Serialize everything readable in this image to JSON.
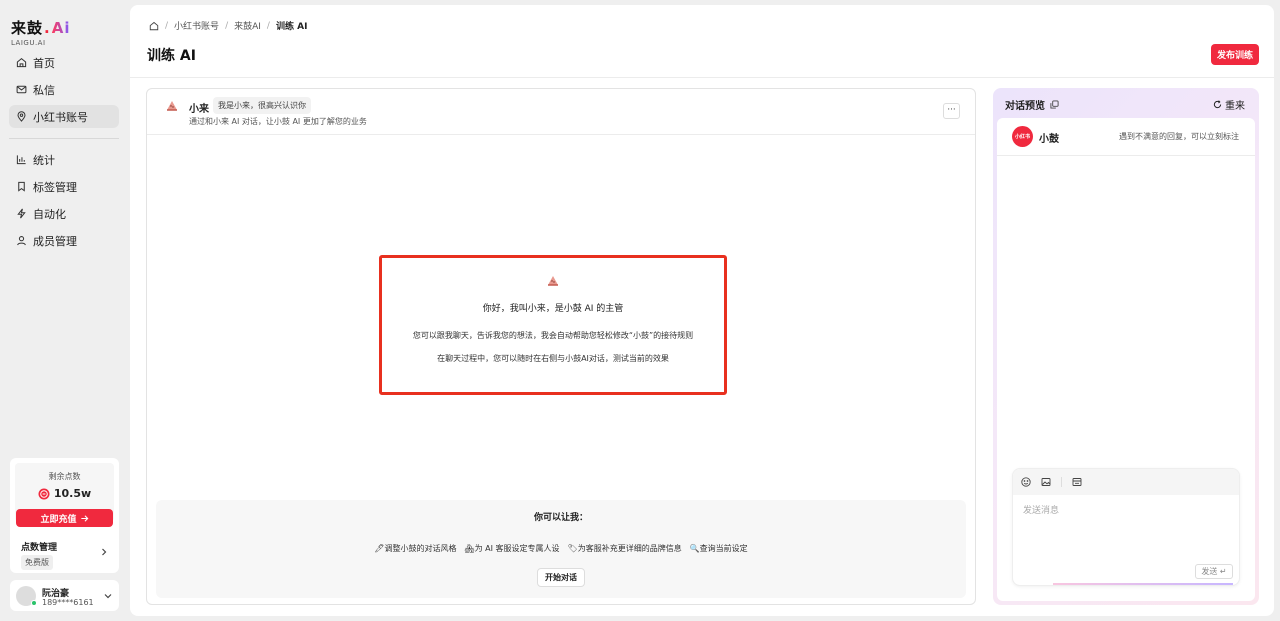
{
  "brand": {
    "name": "来鼓",
    "ai": "Ai",
    "sub": "LAIGU.AI"
  },
  "sidebar": {
    "items": [
      {
        "label": "首页",
        "icon": "home-icon"
      },
      {
        "label": "私信",
        "icon": "mail-icon"
      },
      {
        "label": "小红书账号",
        "icon": "location-pin-icon",
        "active": true
      }
    ],
    "items2": [
      {
        "label": "统计",
        "icon": "bar-chart-icon"
      },
      {
        "label": "标签管理",
        "icon": "bookmark-icon"
      },
      {
        "label": "自动化",
        "icon": "lightning-icon"
      },
      {
        "label": "成员管理",
        "icon": "user-icon"
      }
    ],
    "points": {
      "label": "剩余点数",
      "value": "10.5w",
      "recharge_label": "立即充值",
      "manage_label": "点数管理",
      "plan_badge": "免费版"
    },
    "user": {
      "name": "阮治豪",
      "phone": "189****6161"
    }
  },
  "header": {
    "breadcrumb": [
      "小红书账号",
      "来鼓AI",
      "训练 AI"
    ],
    "title": "训练 AI",
    "publish_label": "发布训练"
  },
  "chat": {
    "bot_name": "小来",
    "bot_tag": "我是小来，很高兴认识你",
    "bot_desc": "通过和小来 AI 对话，让小鼓 AI 更加了解您的业务",
    "more_label": "···",
    "intro_title": "你好，我叫小来，是小鼓 AI 的主管",
    "intro_line1": "您可以跟我聊天，告诉我您的想法，我会自动帮助您轻松修改“小鼓”的接待规则",
    "intro_line2": "在聊天过程中，您可以随时在右侧与小鼓AI对话，测试当前的效果",
    "suggest_title": "你可以让我：",
    "suggestions": [
      "🖊调整小鼓的对话风格",
      "🏘为 AI 客服设定专属人设",
      "🏷为客服补充更详细的品牌信息",
      "🔍查询当前设定"
    ],
    "start_label": "开始对话"
  },
  "preview": {
    "title": "对话预览",
    "restart_label": "重来",
    "bot_name": "小鼓",
    "avatar_text": "小红书",
    "note": "遇到不满意的回复，可以立刻标注",
    "input_placeholder": "发送消息",
    "send_label": "发送 ↵"
  },
  "colors": {
    "accent": "#f0293e",
    "highlight_border": "#e8301f"
  }
}
